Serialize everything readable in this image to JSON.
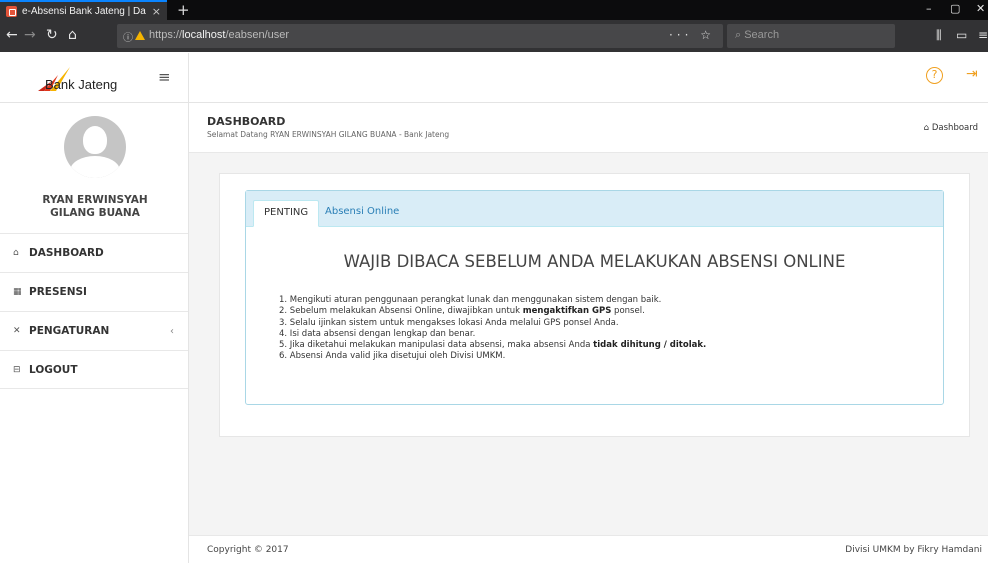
{
  "browser": {
    "tab_title": "e-Absensi Bank Jateng | Dashbo",
    "tab_close": "×",
    "new_tab": "+",
    "url_prefix": "https://",
    "url_host": "localhost",
    "url_path": "/eabsen/user",
    "search_placeholder": "Search",
    "page_actions": "··· ☆",
    "rainbow_colors": [
      "#e84c3d",
      "#9b59b6",
      "#3aa0e0",
      "#2ecc71",
      "#f1c40f",
      "#e67e22",
      "#e84c3d",
      "#c0392b"
    ]
  },
  "header": {
    "logo_text": "Bank Jateng",
    "menu_icon": "≡",
    "help_icon": "?",
    "signout_icon": "⇥"
  },
  "user": {
    "name": "RYAN ERWINSYAH GILANG BUANA"
  },
  "sidebar": {
    "items": [
      {
        "label": "DASHBOARD",
        "icon": "home-icon"
      },
      {
        "label": "PRESENSI",
        "icon": "calendar-icon"
      },
      {
        "label": "PENGATURAN",
        "icon": "wrench-icon",
        "caret": "‹"
      },
      {
        "label": "LOGOUT",
        "icon": "logout-icon"
      }
    ]
  },
  "page": {
    "title": "DASHBOARD",
    "subtitle": "Selamat Datang RYAN ERWINSYAH GILANG BUANA - Bank Jateng",
    "breadcrumb": "Dashboard"
  },
  "panel": {
    "tabs": [
      "PENTING",
      "Absensi Online"
    ],
    "notice_title": "WAJIB DIBACA SEBELUM ANDA MELAKUKAN ABSENSI ONLINE",
    "items": [
      {
        "pre": "1. Mengikuti aturan penggunaan perangkat lunak dan menggunakan sistem dengan baik.",
        "bold": "",
        "post": ""
      },
      {
        "pre": "2. Sebelum melakukan Absensi Online, diwajibkan untuk ",
        "bold": "mengaktifkan GPS",
        "post": " ponsel."
      },
      {
        "pre": "3. Selalu ijinkan sistem untuk mengakses lokasi Anda melalui GPS ponsel Anda.",
        "bold": "",
        "post": ""
      },
      {
        "pre": "4. Isi data absensi dengan lengkap dan benar.",
        "bold": "",
        "post": ""
      },
      {
        "pre": "5. Jika diketahui melakukan manipulasi data absensi, maka absensi Anda ",
        "bold": "tidak dihitung / ditolak.",
        "post": ""
      },
      {
        "pre": "6. Absensi Anda valid jika disetujui oleh Divisi UMKM.",
        "bold": "",
        "post": ""
      }
    ]
  },
  "footer": {
    "copyright": "Copyright © 2017",
    "credit": "Divisi UMKM by Fikry Hamdani"
  }
}
